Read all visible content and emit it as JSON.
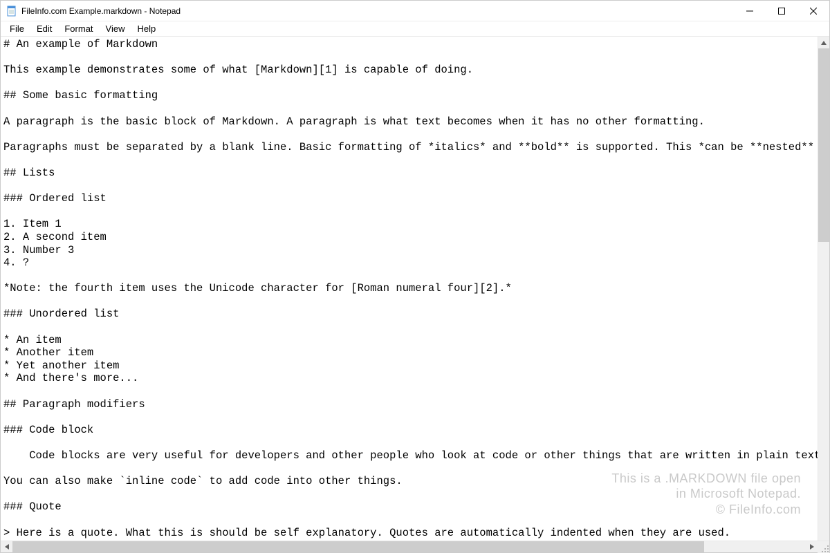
{
  "titlebar": {
    "title": "FileInfo.com Example.markdown - Notepad"
  },
  "menu": {
    "items": [
      "File",
      "Edit",
      "Format",
      "View",
      "Help"
    ]
  },
  "editor": {
    "content": "# An example of Markdown\n\nThis example demonstrates some of what [Markdown][1] is capable of doing.\n\n## Some basic formatting\n\nA paragraph is the basic block of Markdown. A paragraph is what text becomes when it has no other formatting.\n\nParagraphs must be separated by a blank line. Basic formatting of *italics* and **bold** is supported. This *can be **nested** like* so.\n\n## Lists\n\n### Ordered list\n\n1. Item 1\n2. A second item\n3. Number 3\n4. ?\n\n*Note: the fourth item uses the Unicode character for [Roman numeral four][2].*\n\n### Unordered list\n\n* An item\n* Another item\n* Yet another item\n* And there's more...\n\n## Paragraph modifiers\n\n### Code block\n\n    Code blocks are very useful for developers and other people who look at code or other things that are written in plain text. As you can see,\n\nYou can also make `inline code` to add code into other things.\n\n### Quote\n\n> Here is a quote. What this is should be self explanatory. Quotes are automatically indented when they are used."
  },
  "watermark": {
    "line1": "This is a .MARKDOWN file open",
    "line2": "in Microsoft Notepad.",
    "line3": "© FileInfo.com"
  }
}
